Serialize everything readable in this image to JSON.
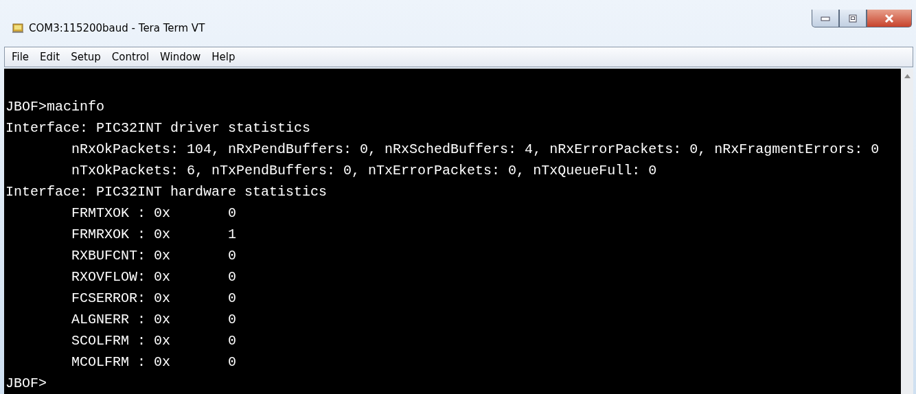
{
  "window": {
    "title": "COM3:115200baud - Tera Term VT"
  },
  "menu": [
    "File",
    "Edit",
    "Setup",
    "Control",
    "Window",
    "Help"
  ],
  "terminal": {
    "lines": [
      "JBOF>macinfo",
      "Interface: PIC32INT driver statistics",
      "        nRxOkPackets: 104, nRxPendBuffers: 0, nRxSchedBuffers: 4, nRxErrorPackets: 0, nRxFragmentErrors: 0",
      "        nTxOkPackets: 6, nTxPendBuffers: 0, nTxErrorPackets: 0, nTxQueueFull: 0",
      "Interface: PIC32INT hardware statistics",
      "        FRMTXOK : 0x       0",
      "        FRMRXOK : 0x       1",
      "        RXBUFCNT: 0x       0",
      "        RXOVFLOW: 0x       0",
      "        FCSERROR: 0x       0",
      "        ALGNERR : 0x       0",
      "        SCOLFRM : 0x       0",
      "        MCOLFRM : 0x       0",
      "JBOF>"
    ]
  }
}
